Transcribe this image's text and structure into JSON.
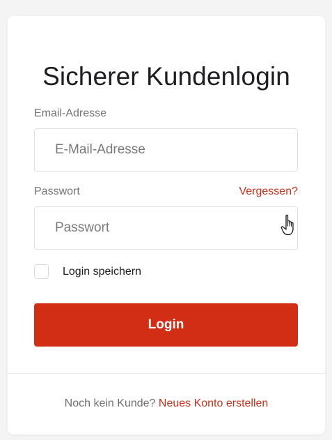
{
  "form": {
    "title": "Sicherer Kundenlogin",
    "email_label": "Email-Adresse",
    "email_placeholder": "E-Mail-Adresse",
    "email_value": "",
    "password_label": "Passwort",
    "password_placeholder": "Passwort",
    "password_value": "",
    "forgot_link": "Vergessen?",
    "remember_label": "Login speichern",
    "remember_checked": false,
    "login_button": "Login"
  },
  "footer": {
    "question": "Noch kein Kunde?",
    "register_link": "Neues Konto erstellen"
  },
  "colors": {
    "accent": "#d22e15",
    "link": "#c9301b",
    "title": "#1d1d22",
    "label": "#757578"
  },
  "cursor": {
    "icon": "hand-pointer-icon"
  }
}
